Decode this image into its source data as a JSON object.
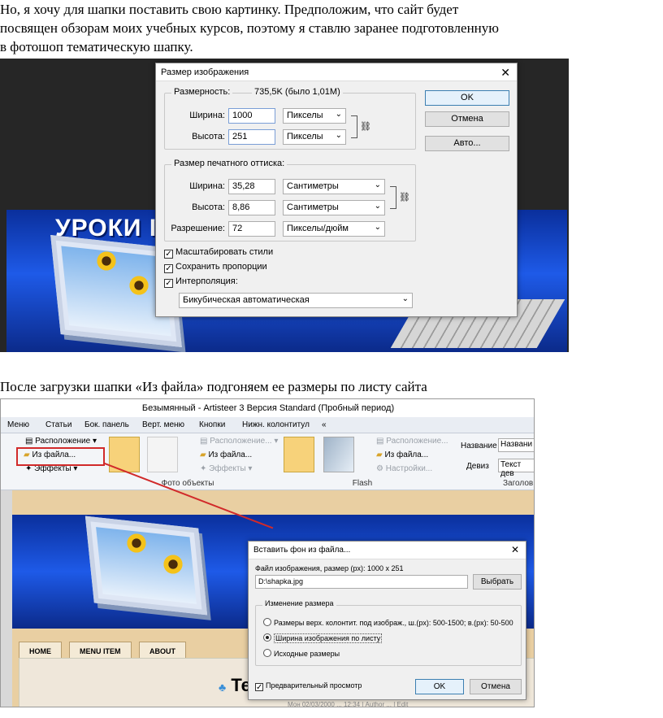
{
  "text": {
    "intro_lines": [
      "Но, я хочу для шапки поставить свою картинку. Предположим, что сайт будет",
      "посвящен обзорам моих учебных курсов, поэтому я ставлю заранее подготовленную",
      "в фотошоп тематическую шапку."
    ],
    "second_paragraph": "После загрузки шапки «Из файла» подгоняем ее размеры по листу сайта"
  },
  "photoshop_dialog": {
    "title": "Размер изображения",
    "dimension_label": "Размерность:",
    "dimension_value": "735,5K (было 1,01M)",
    "pixel_group": {
      "width_label": "Ширина:",
      "width_value": "1000",
      "width_unit": "Пикселы",
      "height_label": "Высота:",
      "height_value": "251",
      "height_unit": "Пикселы"
    },
    "print_group": {
      "label": "Размер печатного оттиска:",
      "width_label": "Ширина:",
      "width_value": "35,28",
      "width_unit": "Сантиметры",
      "height_label": "Высота:",
      "height_value": "8,86",
      "height_unit": "Сантиметры",
      "resolution_label": "Разрешение:",
      "resolution_value": "72",
      "resolution_unit": "Пикселы/дюйм"
    },
    "checkboxes": [
      {
        "label": "Масштабировать стили",
        "checked": true
      },
      {
        "label": "Сохранить пропорции",
        "checked": true
      },
      {
        "label": "Интерполяция:",
        "checked": true
      }
    ],
    "interpolation": "Бикубическая автоматическая",
    "buttons": {
      "ok": "OK",
      "cancel": "Отмена",
      "auto": "Авто..."
    },
    "banner_text": "УРОКИ I"
  },
  "artisteer": {
    "title": "Безымянный - Artisteer 3 Версия Standard (Пробный период)",
    "menu": [
      "Меню",
      "Статьи",
      "Бок. панель",
      "Верт. меню",
      "Кнопки",
      "Нижн. колонтитул",
      "«"
    ],
    "ribbon": {
      "layout": "Расположение",
      "from_file": "Из файла...",
      "effects": "Эффекты",
      "layout2": "Расположение...",
      "from_file2": "Из файла...",
      "effects2": "Эффекты",
      "layout3": "Расположение...",
      "from_file3": "Из файла...",
      "settings": "Настройки...",
      "name_label": "Название",
      "name_value": "Названи",
      "motto_label": "Девиз",
      "motto_value": "Текст дев",
      "group_photo": "Фото объекты",
      "group_flash": "Flash",
      "group_title": "Заголов"
    },
    "nav_tabs": [
      "HOME",
      "MENU ITEM",
      "ABOUT"
    ],
    "logo_text": "Те",
    "footer_snippet": "Мон 02/03/2000 ... 12:34 | Author ... | Edit"
  },
  "insert_dialog": {
    "title": "Вставить фон из файла...",
    "file_label": "Файл изображения, размер (px): 1000 x 251",
    "file_value": "D:\\shapka.jpg",
    "browse": "Выбрать",
    "resize_group": "Изменение размера",
    "options": [
      {
        "label": "Размеры верх. колонтит. под изображ., ш.(px): 500-1500; в.(px): 50-500",
        "selected": false
      },
      {
        "label": "Ширина изображения по листу",
        "selected": true
      },
      {
        "label": "Исходные размеры",
        "selected": false
      }
    ],
    "preview_label": "Предварительный просмотр",
    "preview_checked": true,
    "ok": "OK",
    "cancel": "Отмена"
  },
  "colors": {
    "highlight": "#d12a2a",
    "banner_blue": "#1e5ae8",
    "page_bg": "#e9cfa2"
  }
}
